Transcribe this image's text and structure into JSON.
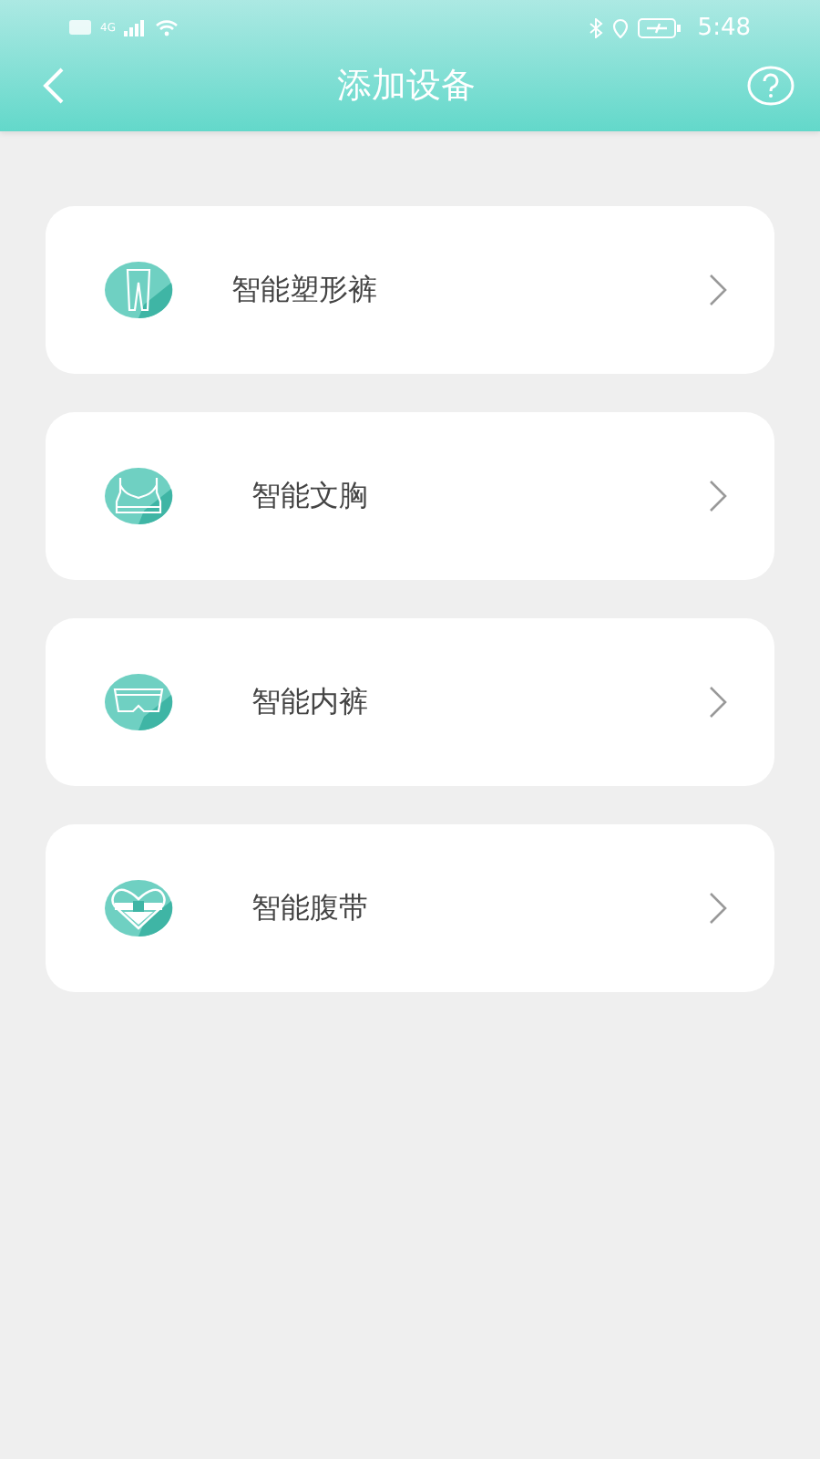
{
  "status_bar": {
    "network": "4G",
    "time": "5:48"
  },
  "header": {
    "title": "添加设备"
  },
  "devices": [
    {
      "kind": "leggings",
      "label": "智能塑形裤"
    },
    {
      "kind": "bra",
      "label": "智能文胸"
    },
    {
      "kind": "briefs",
      "label": "智能内裤"
    },
    {
      "kind": "belt",
      "label": "智能腹带"
    }
  ]
}
